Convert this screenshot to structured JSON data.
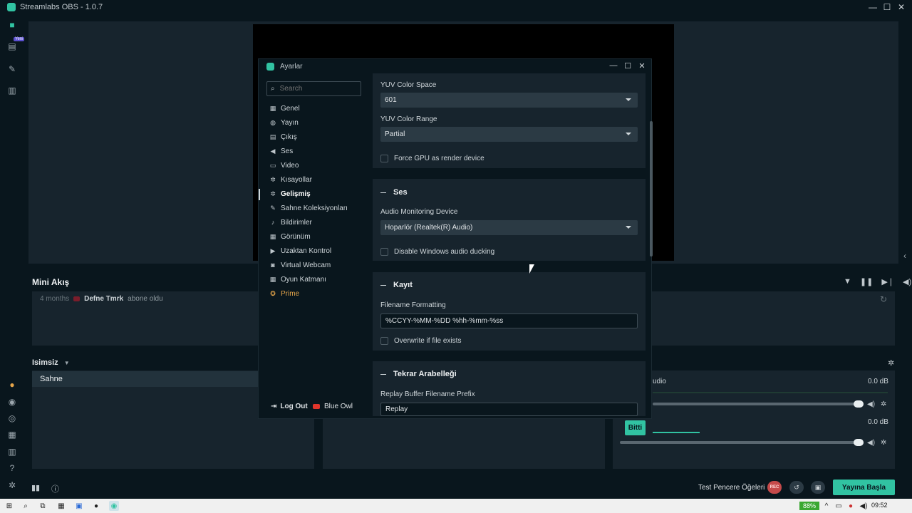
{
  "window": {
    "title": "Streamlabs OBS - 1.0.7"
  },
  "nav": {
    "new_badge": "Yeni"
  },
  "minifeed": {
    "title": "Mini Akış",
    "item": {
      "time": "4 months",
      "name": "Defne Tmrk",
      "action": "abone oldu"
    }
  },
  "scenes": {
    "collection": "Isimsiz",
    "items": [
      "Sahne"
    ]
  },
  "mixer": {
    "tracks": [
      {
        "label": "udio",
        "db": "0.0 dB"
      },
      {
        "label": "",
        "db": "0.0 dB"
      }
    ]
  },
  "footer": {
    "test_label": "Test Pencere Öğeleri",
    "rec_label": "REC",
    "go_live": "Yayına Başla"
  },
  "taskbar": {
    "battery": "88%",
    "time": "09:52"
  },
  "settings": {
    "title": "Ayarlar",
    "search_placeholder": "Search",
    "menu": [
      {
        "label": "Genel",
        "icon": "grid-icon"
      },
      {
        "label": "Yayın",
        "icon": "globe-icon"
      },
      {
        "label": "Çıkış",
        "icon": "output-icon"
      },
      {
        "label": "Ses",
        "icon": "speaker-icon"
      },
      {
        "label": "Video",
        "icon": "film-icon"
      },
      {
        "label": "Kısayollar",
        "icon": "gear-icon"
      },
      {
        "label": "Gelişmiş",
        "icon": "gears-icon",
        "active": true
      },
      {
        "label": "Sahne Koleksiyonları",
        "icon": "wand-icon"
      },
      {
        "label": "Bildirimler",
        "icon": "bell-icon"
      },
      {
        "label": "Görünüm",
        "icon": "palette-icon"
      },
      {
        "label": "Uzaktan Kontrol",
        "icon": "remote-icon"
      },
      {
        "label": "Virtual Webcam",
        "icon": "camera-icon"
      },
      {
        "label": "Oyun Katmanı",
        "icon": "overlay-icon"
      },
      {
        "label": "Prime",
        "icon": "prime-icon"
      }
    ],
    "logout": "Log Out",
    "account": "Blue Owl",
    "done": "Bitti",
    "video": {
      "color_space_label": "YUV Color Space",
      "color_space_value": "601",
      "color_range_label": "YUV Color Range",
      "color_range_value": "Partial",
      "force_gpu_label": "Force GPU as render device"
    },
    "audio": {
      "title": "Ses",
      "monitoring_label": "Audio Monitoring Device",
      "monitoring_value": "Hoparlör (Realtek(R) Audio)",
      "ducking_label": "Disable Windows audio ducking"
    },
    "recording": {
      "title": "Kayıt",
      "filename_label": "Filename Formatting",
      "filename_value": "%CCYY-%MM-%DD %hh-%mm-%ss",
      "overwrite_label": "Overwrite if file exists"
    },
    "replay": {
      "title": "Tekrar Arabelleği",
      "prefix_label": "Replay Buffer Filename Prefix",
      "prefix_value": "Replay"
    }
  }
}
